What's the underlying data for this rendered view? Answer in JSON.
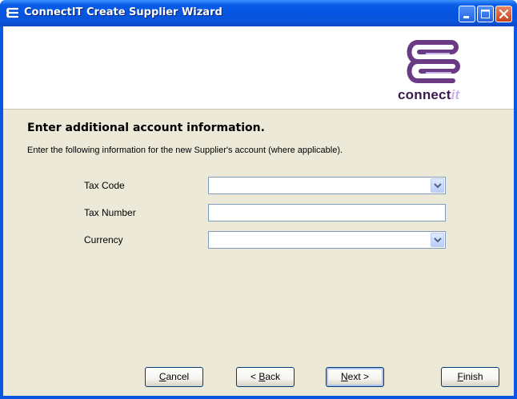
{
  "window": {
    "title": "ConnectIT Create Supplier Wizard",
    "icon": "connectit-app-icon",
    "controls": {
      "minimize": "minimize-icon",
      "maximize": "maximize-icon",
      "close": "close-icon"
    }
  },
  "header": {
    "logo_word": "connect",
    "logo_suffix": "it",
    "logo_colors": {
      "mark": "#6a3a85",
      "mark_light": "#c8b3e6",
      "word": "#3b1a4f"
    }
  },
  "page": {
    "heading": "Enter additional account information.",
    "instruction": "Enter the following information for the new Supplier's account (where applicable)."
  },
  "form": {
    "tax_code": {
      "label": "Tax Code",
      "value": ""
    },
    "tax_number": {
      "label": "Tax Number",
      "value": ""
    },
    "currency": {
      "label": "Currency",
      "value": ""
    }
  },
  "buttons": {
    "cancel": {
      "mnemonic": "C",
      "rest": "ancel"
    },
    "back": {
      "prefix": "< ",
      "mnemonic": "B",
      "rest": "ack"
    },
    "next": {
      "mnemonic": "N",
      "rest": "ext >"
    },
    "finish": {
      "mnemonic": "F",
      "rest": "inish"
    }
  },
  "colors": {
    "titlebar": "#0454e0",
    "dialog_bg": "#ece9d8",
    "close_button": "#c9431a"
  }
}
